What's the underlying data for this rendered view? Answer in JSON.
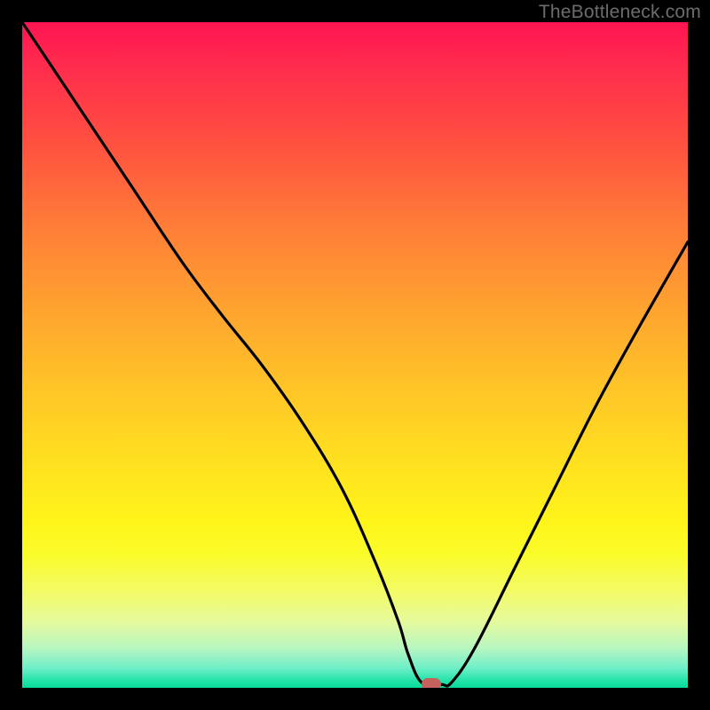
{
  "watermark": "TheBottleneck.com",
  "chart_data": {
    "type": "line",
    "title": "",
    "xlabel": "",
    "ylabel": "",
    "xlim": [
      0,
      100
    ],
    "ylim": [
      0,
      100
    ],
    "grid": false,
    "series": [
      {
        "name": "bottleneck-curve",
        "x": [
          0,
          8,
          16,
          24,
          30,
          36,
          42,
          48,
          53,
          56.5,
          58,
          60,
          63,
          64.5,
          68,
          74,
          80,
          86,
          92,
          100
        ],
        "y": [
          100,
          88,
          76,
          64,
          56,
          48.5,
          40,
          30,
          19,
          10,
          5,
          0.8,
          0.5,
          0.8,
          6,
          18,
          30,
          42,
          53,
          67
        ]
      }
    ],
    "marker": {
      "x": 61.5,
      "y": 0.6,
      "color": "#c5625e"
    },
    "gradient": {
      "top_color": "#ff1452",
      "bottom_color": "#06d998"
    }
  }
}
